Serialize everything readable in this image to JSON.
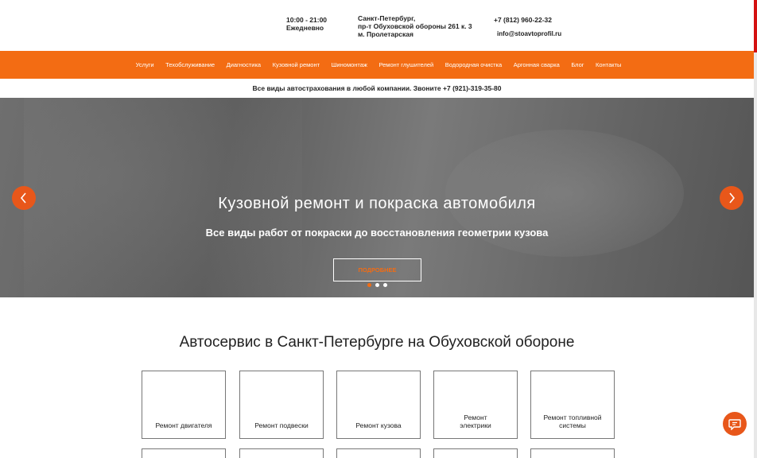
{
  "header": {
    "hours": "10:00 - 21:00",
    "days": "Ежедневно",
    "address_line1": "Санкт-Петербург,",
    "address_line2": "пр-т Обуховской обороны 261 к. 3",
    "address_line3": "м. Пролетарская",
    "phone": "+7 (812) 960-22-32",
    "email": "info@stoavtoprofil.ru"
  },
  "nav": {
    "items": [
      {
        "label": "Услуги"
      },
      {
        "label": "Техобслуживание"
      },
      {
        "label": "Диагностика"
      },
      {
        "label": "Кузовной ремонт"
      },
      {
        "label": "Шиномонтаж"
      },
      {
        "label": "Ремонт глушителей"
      },
      {
        "label": "Водородная очистка"
      },
      {
        "label": "Аргонная сварка"
      },
      {
        "label": "Блог"
      },
      {
        "label": "Контакты"
      }
    ]
  },
  "promo": {
    "text": "Все виды автострахования в любой компании. Звоните +7 (921)-319-35-80"
  },
  "hero": {
    "title": "Кузовной ремонт и покраска автомобиля",
    "subtitle": "Все виды работ от покраски до восстановления геометрии кузова",
    "button": "ПОДРОБНЕЕ",
    "slides_count": 3,
    "active_slide": 1
  },
  "services": {
    "title": "Автосервис в Санкт-Петербурге на Обуховской обороне",
    "cards": [
      {
        "label": "Ремонт двигателя"
      },
      {
        "label": "Ремонт подвески"
      },
      {
        "label": "Ремонт кузова"
      },
      {
        "label": "Ремонт электрики"
      },
      {
        "label": "Ремонт топливной системы"
      }
    ]
  },
  "colors": {
    "accent": "#f36c13",
    "arrow": "#e8571a"
  },
  "icons": {
    "prev": "chevron-left-icon",
    "next": "chevron-right-icon",
    "chat": "chat-icon"
  }
}
